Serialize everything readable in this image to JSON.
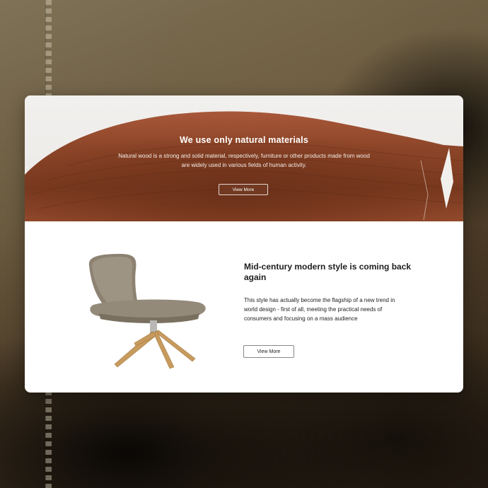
{
  "hero": {
    "title": "We use only natural materials",
    "text": "Natural wood is a strong and solid material, respectively, furniture or other products made from wood are widely used in various fields of human activity.",
    "button_label": "View More"
  },
  "product": {
    "title": "Mid-century modern style is coming back again",
    "text": "This style has actually become the flagship of a new trend in world design - first of all, meeting the practical needs of consumers and focusing on a mass audience",
    "button_label": "View More",
    "image": "chair-image"
  },
  "colors": {
    "wood": "#8a4325",
    "wood_dark": "#5e2a16",
    "card_bg": "#ffffff",
    "text_dark": "#1e1e1e"
  }
}
